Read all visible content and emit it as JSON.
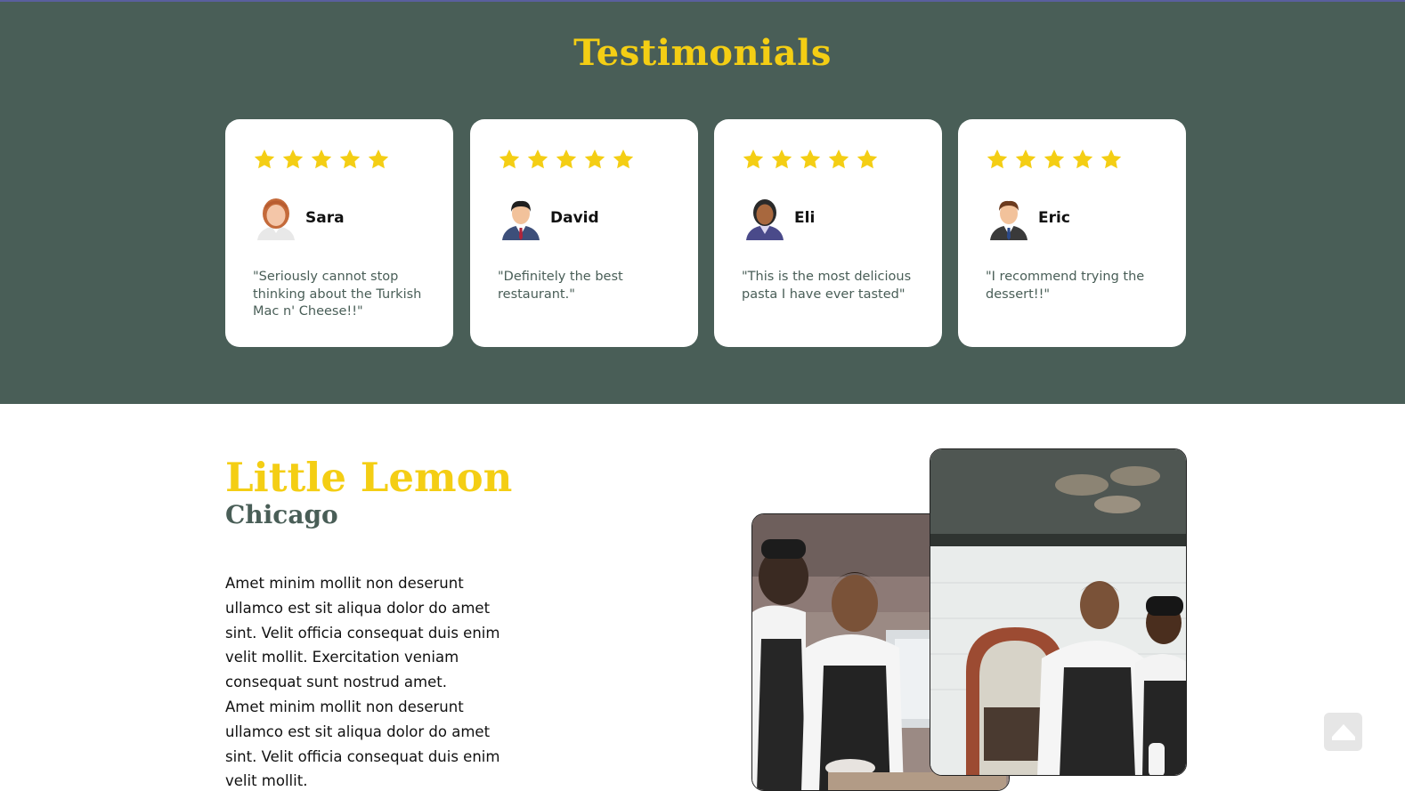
{
  "testimonials": {
    "title": "Testimonials",
    "star_color": "#f4ce14",
    "cards": [
      {
        "name": "Sara",
        "rating": 5,
        "avatar": "woman-avatar-icon",
        "quote": "\"Seriously cannot stop thinking about the Turkish Mac n' Cheese!!\""
      },
      {
        "name": "David",
        "rating": 5,
        "avatar": "man-avatar-icon",
        "quote": "\"Definitely the best restaurant.\""
      },
      {
        "name": "Eli",
        "rating": 5,
        "avatar": "man-avatar-icon",
        "quote": "\"This is the most delicious pasta I have ever tasted\""
      },
      {
        "name": "Eric",
        "rating": 5,
        "avatar": "man-avatar-icon",
        "quote": "\"I recommend trying the dessert!!\""
      }
    ]
  },
  "about": {
    "title": "Little Lemon",
    "subtitle": "Chicago",
    "paragraph_1": "Amet minim mollit non deserunt ullamco est sit aliqua dolor do amet sint. Velit officia consequat duis enim velit mollit. Exercitation veniam consequat sunt nostrud amet.",
    "paragraph_2": "Amet minim mollit non deserunt ullamco est sit aliqua dolor do amet sint. Velit officia consequat duis enim velit mollit."
  },
  "scroll_top": {
    "icon": "arrow-up-icon"
  },
  "colors": {
    "primary_green": "#495e57",
    "primary_yellow": "#f4ce14"
  }
}
